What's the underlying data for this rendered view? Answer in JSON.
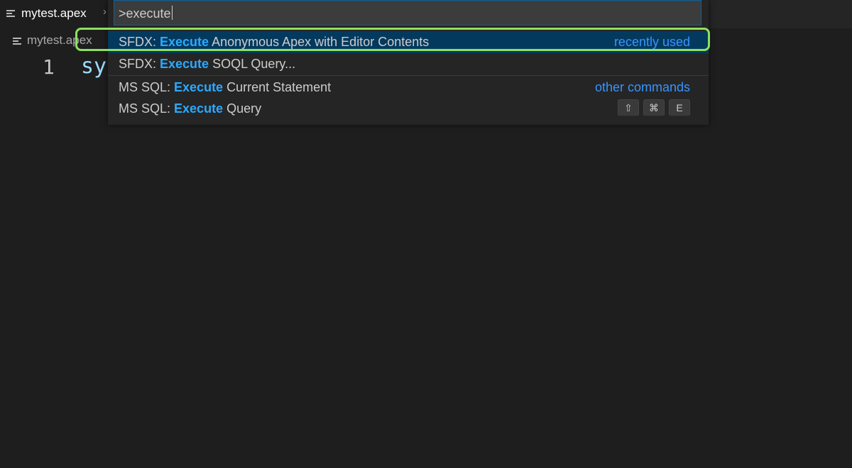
{
  "tab": {
    "title": "mytest.apex",
    "close_glyph": "›"
  },
  "breadcrumb": {
    "file": "mytest.apex"
  },
  "editor": {
    "line_number": "1",
    "code": "sy"
  },
  "palette": {
    "query": ">execute",
    "items": [
      {
        "prefix": "SFDX: ",
        "match": "Execute",
        "suffix": " Anonymous Apex with Editor Contents",
        "right": "recently used",
        "selected": true
      },
      {
        "prefix": "SFDX: ",
        "match": "Execute",
        "suffix": " SOQL Query...",
        "right": ""
      },
      {
        "prefix": "MS SQL: ",
        "match": "Execute",
        "suffix": " Current Statement",
        "right": "other commands"
      },
      {
        "prefix": "MS SQL: ",
        "match": "Execute",
        "suffix": " Query",
        "right": ""
      }
    ],
    "keybinding": [
      "⇧",
      "⌘",
      "E"
    ]
  },
  "colors": {
    "highlight": "#2aaaff",
    "selection": "#04395e",
    "annotation_ring": "#8ce060"
  }
}
